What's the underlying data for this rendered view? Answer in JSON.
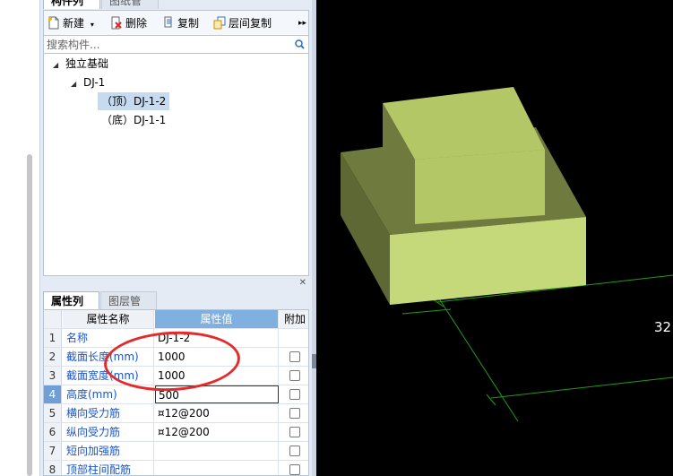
{
  "top_tabs": [
    "构件列表",
    "图纸管理"
  ],
  "toolbar": {
    "new_label": "新建",
    "delete_label": "删除",
    "copy_label": "复制",
    "floor_copy_label": "层间复制",
    "more_label": "▸▸"
  },
  "search": {
    "placeholder": "搜索构件..."
  },
  "tree": {
    "root": "独立基础",
    "child": "DJ-1",
    "leaf_top": "（顶）DJ-1-2",
    "leaf_bottom": "（底）DJ-1-1"
  },
  "prop_tabs": [
    "属性列表",
    "图层管理"
  ],
  "grid": {
    "headers": {
      "name": "属性名称",
      "value": "属性值",
      "add": "附加"
    },
    "rows": [
      {
        "num": "1",
        "name": "名称",
        "value": "DJ-1-2"
      },
      {
        "num": "2",
        "name": "截面长度(mm)",
        "value": "1000"
      },
      {
        "num": "3",
        "name": "截面宽度(mm)",
        "value": "1000"
      },
      {
        "num": "4",
        "name": "高度(mm)",
        "value": "500"
      },
      {
        "num": "5",
        "name": "横向受力筋",
        "value": "¤12@200"
      },
      {
        "num": "6",
        "name": "纵向受力筋",
        "value": "¤12@200"
      },
      {
        "num": "7",
        "name": "短向加强筋",
        "value": ""
      },
      {
        "num": "8",
        "name": "顶部柱间配筋",
        "value": ""
      }
    ]
  },
  "viewport": {
    "dimension_label": "32"
  },
  "colors": {
    "block_top": "#b4c766",
    "block_side_dark": "#6f7a3e",
    "block_front": "#c5d97a",
    "grid_line": "#1f9b1f",
    "annotation": "#e32b2b"
  }
}
